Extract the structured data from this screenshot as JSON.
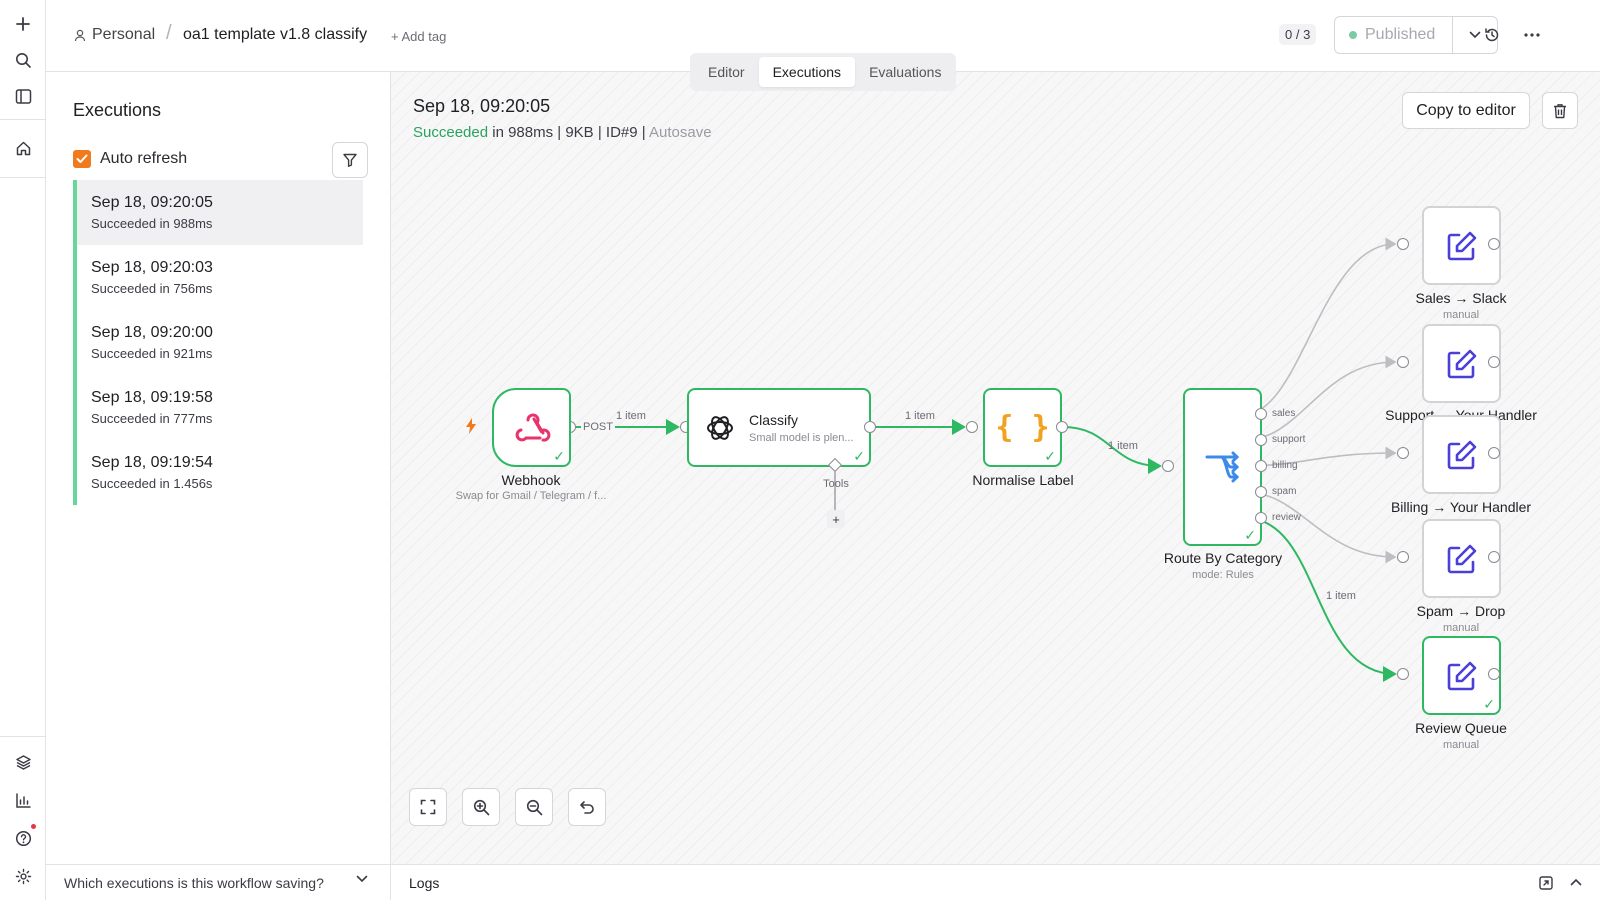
{
  "rail": {
    "icons": [
      "plus-icon",
      "search-icon",
      "sidebar-toggle-icon",
      "home-icon",
      "templates-icon",
      "insights-icon",
      "help-icon",
      "settings-icon"
    ]
  },
  "header": {
    "personal": "Personal",
    "workflow_title": "oa1 template v1.8 classify",
    "add_tag": "+ Add tag",
    "counter": "0 / 3",
    "publish_label": "Published"
  },
  "tabs": [
    "Editor",
    "Executions",
    "Evaluations"
  ],
  "active_tab": "Executions",
  "executions": {
    "title": "Executions",
    "auto_refresh_label": "Auto refresh",
    "auto_refresh_checked": true,
    "items": [
      {
        "time": "Sep 18, 09:20:05",
        "status": "Succeeded in 988ms"
      },
      {
        "time": "Sep 18, 09:20:03",
        "status": "Succeeded in 756ms"
      },
      {
        "time": "Sep 18, 09:20:00",
        "status": "Succeeded in 921ms"
      },
      {
        "time": "Sep 18, 09:19:58",
        "status": "Succeeded in 777ms"
      },
      {
        "time": "Sep 18, 09:19:54",
        "status": "Succeeded in 1.456s"
      }
    ],
    "saving_question": "Which executions is this workflow saving?"
  },
  "detail": {
    "date": "Sep 18, 09:20:05",
    "status_word": "Succeeded",
    "status_rest": " in 988ms | 9KB | ID#9 | ",
    "autosave": "Autosave",
    "copy_button": "Copy to editor"
  },
  "logs_label": "Logs",
  "nodes": {
    "webhook": {
      "label": "Webhook",
      "sub": "Swap for Gmail / Telegram / f..."
    },
    "classify": {
      "label": "Classify",
      "sub": "Small model is plen..."
    },
    "tools": "Tools",
    "normalise": {
      "label": "Normalise Label"
    },
    "route": {
      "label": "Route By Category",
      "sub": "mode: Rules",
      "outputs": [
        "sales",
        "support",
        "billing",
        "spam",
        "review"
      ]
    },
    "sales": {
      "label": "Sales → Slack",
      "sub": "manual"
    },
    "support": {
      "label": "Support → Your Handler"
    },
    "billing": {
      "label": "Billing → Your Handler"
    },
    "spam": {
      "label": "Spam → Drop",
      "sub": "manual"
    },
    "review": {
      "label": "Review Queue",
      "sub": "manual"
    }
  },
  "edges": {
    "post": "POST",
    "one_item": "1 item"
  },
  "colors": {
    "success": "#2fb862",
    "accent": "#f07b1e",
    "edge_grey": "#bdbdc2"
  }
}
